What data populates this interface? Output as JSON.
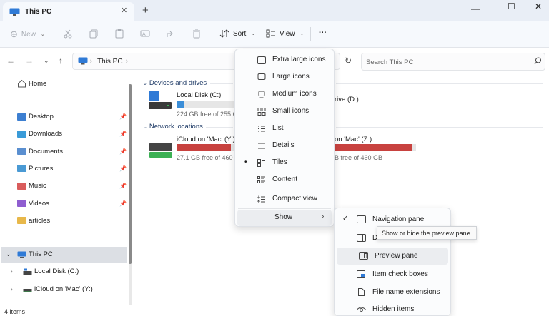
{
  "window": {
    "tab_title": "This PC",
    "new_tab": "+",
    "minimize": "—",
    "maximize": "☐",
    "close": "✕"
  },
  "toolbar": {
    "new_label": "New",
    "sort_label": "Sort",
    "view_label": "View",
    "more_label": "···"
  },
  "address": {
    "crumb": "This PC",
    "search_placeholder": "Search This PC"
  },
  "sidebar": {
    "home": "Home",
    "quick_access": [
      {
        "label": "Desktop",
        "color": "#3d7fd1"
      },
      {
        "label": "Downloads",
        "color": "#3a9bd8"
      },
      {
        "label": "Documents",
        "color": "#5a8fd0"
      },
      {
        "label": "Pictures",
        "color": "#4a9ad4"
      },
      {
        "label": "Music",
        "color": "#d95c5c"
      },
      {
        "label": "Videos",
        "color": "#8f5ed0"
      },
      {
        "label": "articles",
        "color": "#e8b84a"
      }
    ],
    "this_pc": "This PC",
    "drives": [
      "Local Disk (C:)",
      "iCloud on 'Mac' (Y:)"
    ],
    "status": "4 items"
  },
  "content": {
    "devices_header": "Devices and drives",
    "network_header": "Network locations",
    "local_disk": {
      "name": "Local Disk (C:)",
      "free": "224 GB free of 255 G",
      "fill": 0.12,
      "color": "#3b8ed8"
    },
    "drive_d": {
      "name_partial": "rive (D:)"
    },
    "icloud_y": {
      "name": "iCloud on 'Mac' (Y:)",
      "free": "27.1 GB free of 460",
      "fill": 0.94,
      "color": "#c8423f"
    },
    "icloud_z": {
      "name_partial": "on 'Mac' (Z:)",
      "free_partial": "B free of 460 GB",
      "fill": 0.95,
      "color": "#c8423f"
    }
  },
  "view_menu": {
    "items": [
      "Extra large icons",
      "Large icons",
      "Medium icons",
      "Small icons",
      "List",
      "Details",
      "Tiles",
      "Content",
      "Compact view",
      "Show"
    ],
    "selected": "Tiles"
  },
  "show_menu": {
    "items": [
      "Navigation pane",
      "Details pane",
      "Preview pane",
      "Item check boxes",
      "File name extensions",
      "Hidden items"
    ],
    "checked": "Navigation pane",
    "tooltip": "Show or hide the preview pane."
  }
}
